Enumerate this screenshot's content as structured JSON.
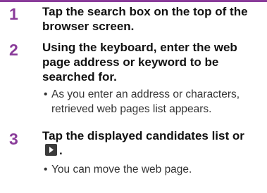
{
  "steps": [
    {
      "number": "1",
      "title": "Tap the search box on the top of the browser screen."
    },
    {
      "number": "2",
      "title": "Using the keyboard, enter the web page address or keyword to be searched for.",
      "bullet": "As you enter an address or characters, retrieved web pages list appears."
    },
    {
      "number": "3",
      "title_before_icon": "Tap the displayed candidates list or",
      "title_after_icon": ".",
      "icon": "forward-arrow-icon",
      "bullet": "You can move the web page."
    }
  ],
  "colors": {
    "accent": "#8a3c9a",
    "icon_bg": "#3b3b3b"
  }
}
